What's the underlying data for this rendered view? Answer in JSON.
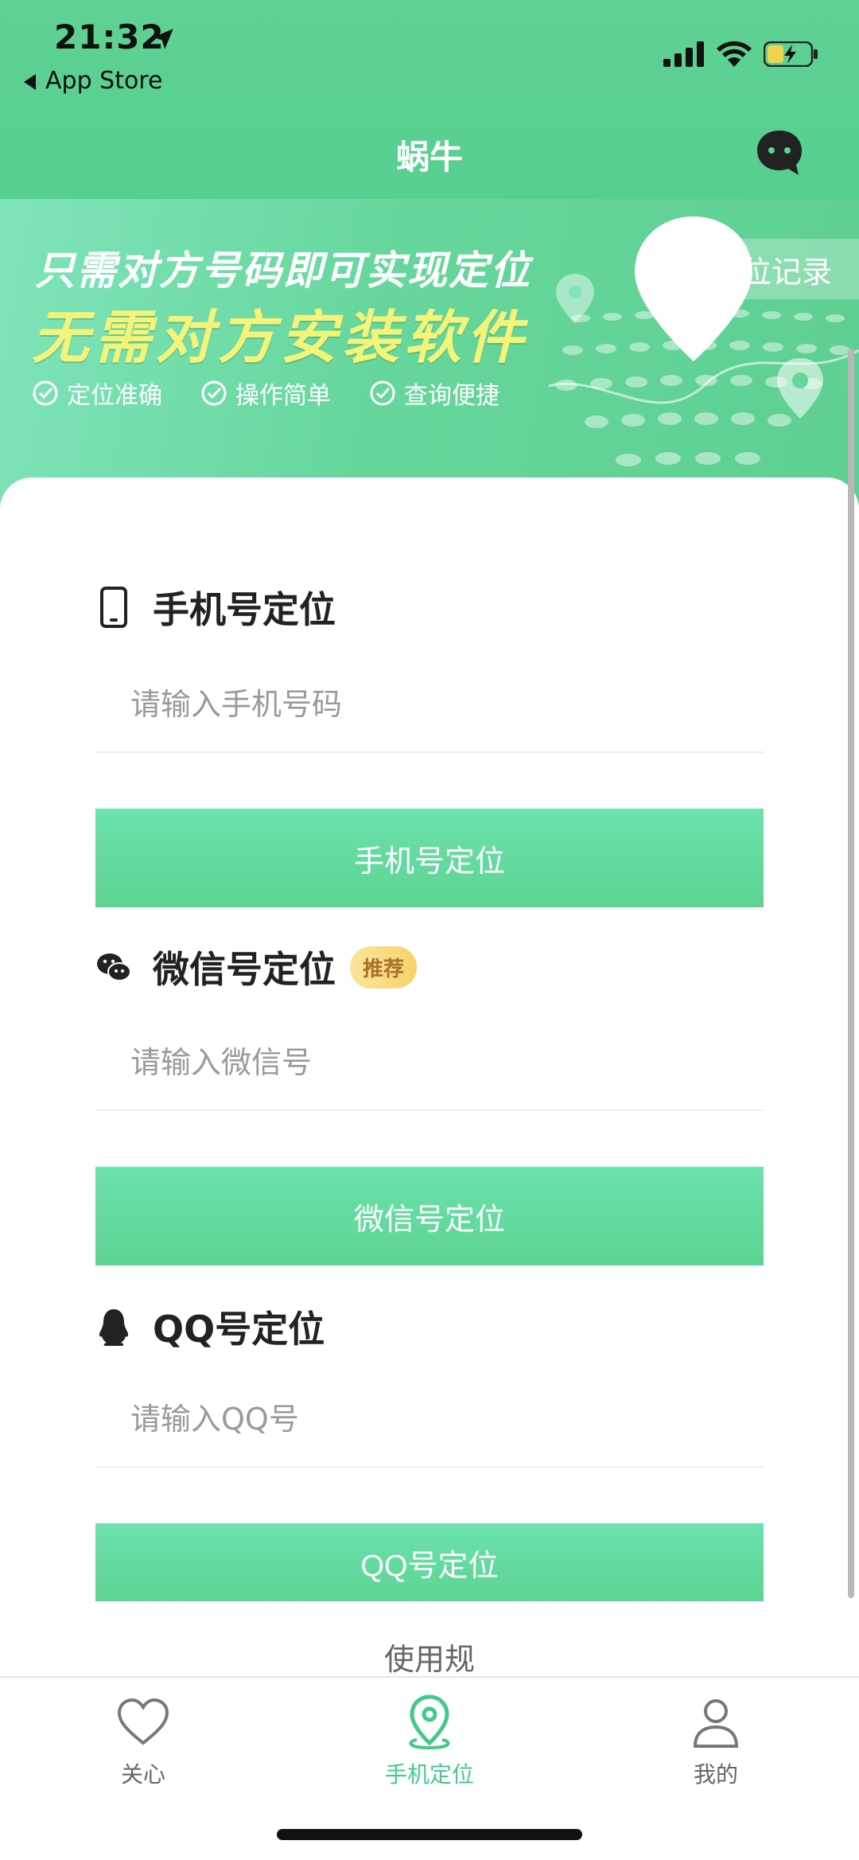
{
  "status_bar": {
    "time": "21:32",
    "back_label": "App Store"
  },
  "navbar": {
    "title": "蜗牛"
  },
  "banner": {
    "line1": "只需对方号码即可实现定位",
    "line2": "无需对方安装软件",
    "features": [
      "定位准确",
      "操作简单",
      "查询便捷"
    ],
    "record_button": "定位记录"
  },
  "sections": {
    "phone": {
      "title": "手机号定位",
      "placeholder": "请输入手机号码",
      "button": "手机号定位"
    },
    "wechat": {
      "title": "微信号定位",
      "badge": "推荐",
      "placeholder": "请输入微信号",
      "button": "微信号定位"
    },
    "qq": {
      "title": "QQ号定位",
      "placeholder": "请输入QQ号",
      "button": "QQ号定位"
    }
  },
  "rules_link": "使用规",
  "tabbar": {
    "tabs": [
      {
        "label": "关心",
        "icon": "heart-icon"
      },
      {
        "label": "手机定位",
        "icon": "location-pin-icon",
        "active": true
      },
      {
        "label": "我的",
        "icon": "person-icon"
      }
    ]
  },
  "colors": {
    "brand_green": "#5dd393",
    "badge_yellow": "#f6d36b",
    "banner_yellow_text": "#f4f47a"
  }
}
